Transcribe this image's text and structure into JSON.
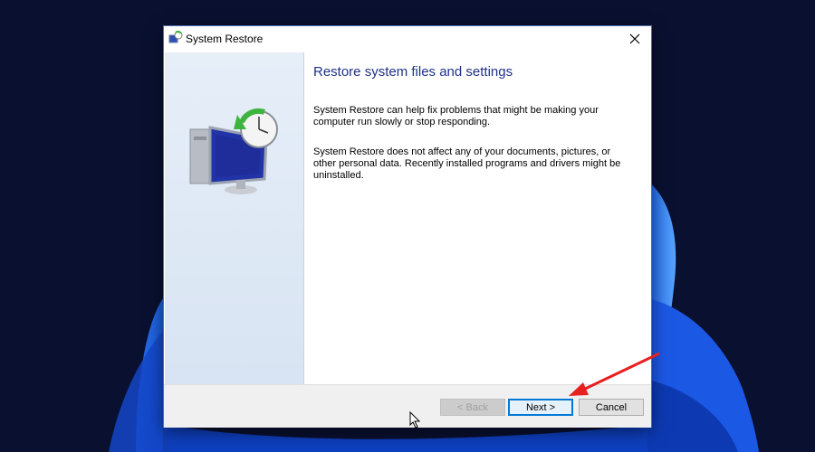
{
  "window": {
    "title": "System Restore",
    "close_glyph": "✕"
  },
  "content": {
    "heading": "Restore system files and settings",
    "paragraph1": "System Restore can help fix problems that might be making your computer run slowly or stop responding.",
    "paragraph2": "System Restore does not affect any of your documents, pictures, or other personal data. Recently installed programs and drivers might be uninstalled."
  },
  "buttons": {
    "back": "< Back",
    "next": "Next >",
    "cancel": "Cancel"
  },
  "icons": {
    "title": "system-restore-icon",
    "hero": "computer-clock-restore-icon",
    "close": "close-icon"
  },
  "colors": {
    "heading": "#1e3287",
    "accent": "#0078d7",
    "annotation_arrow": "#e81f1f"
  }
}
